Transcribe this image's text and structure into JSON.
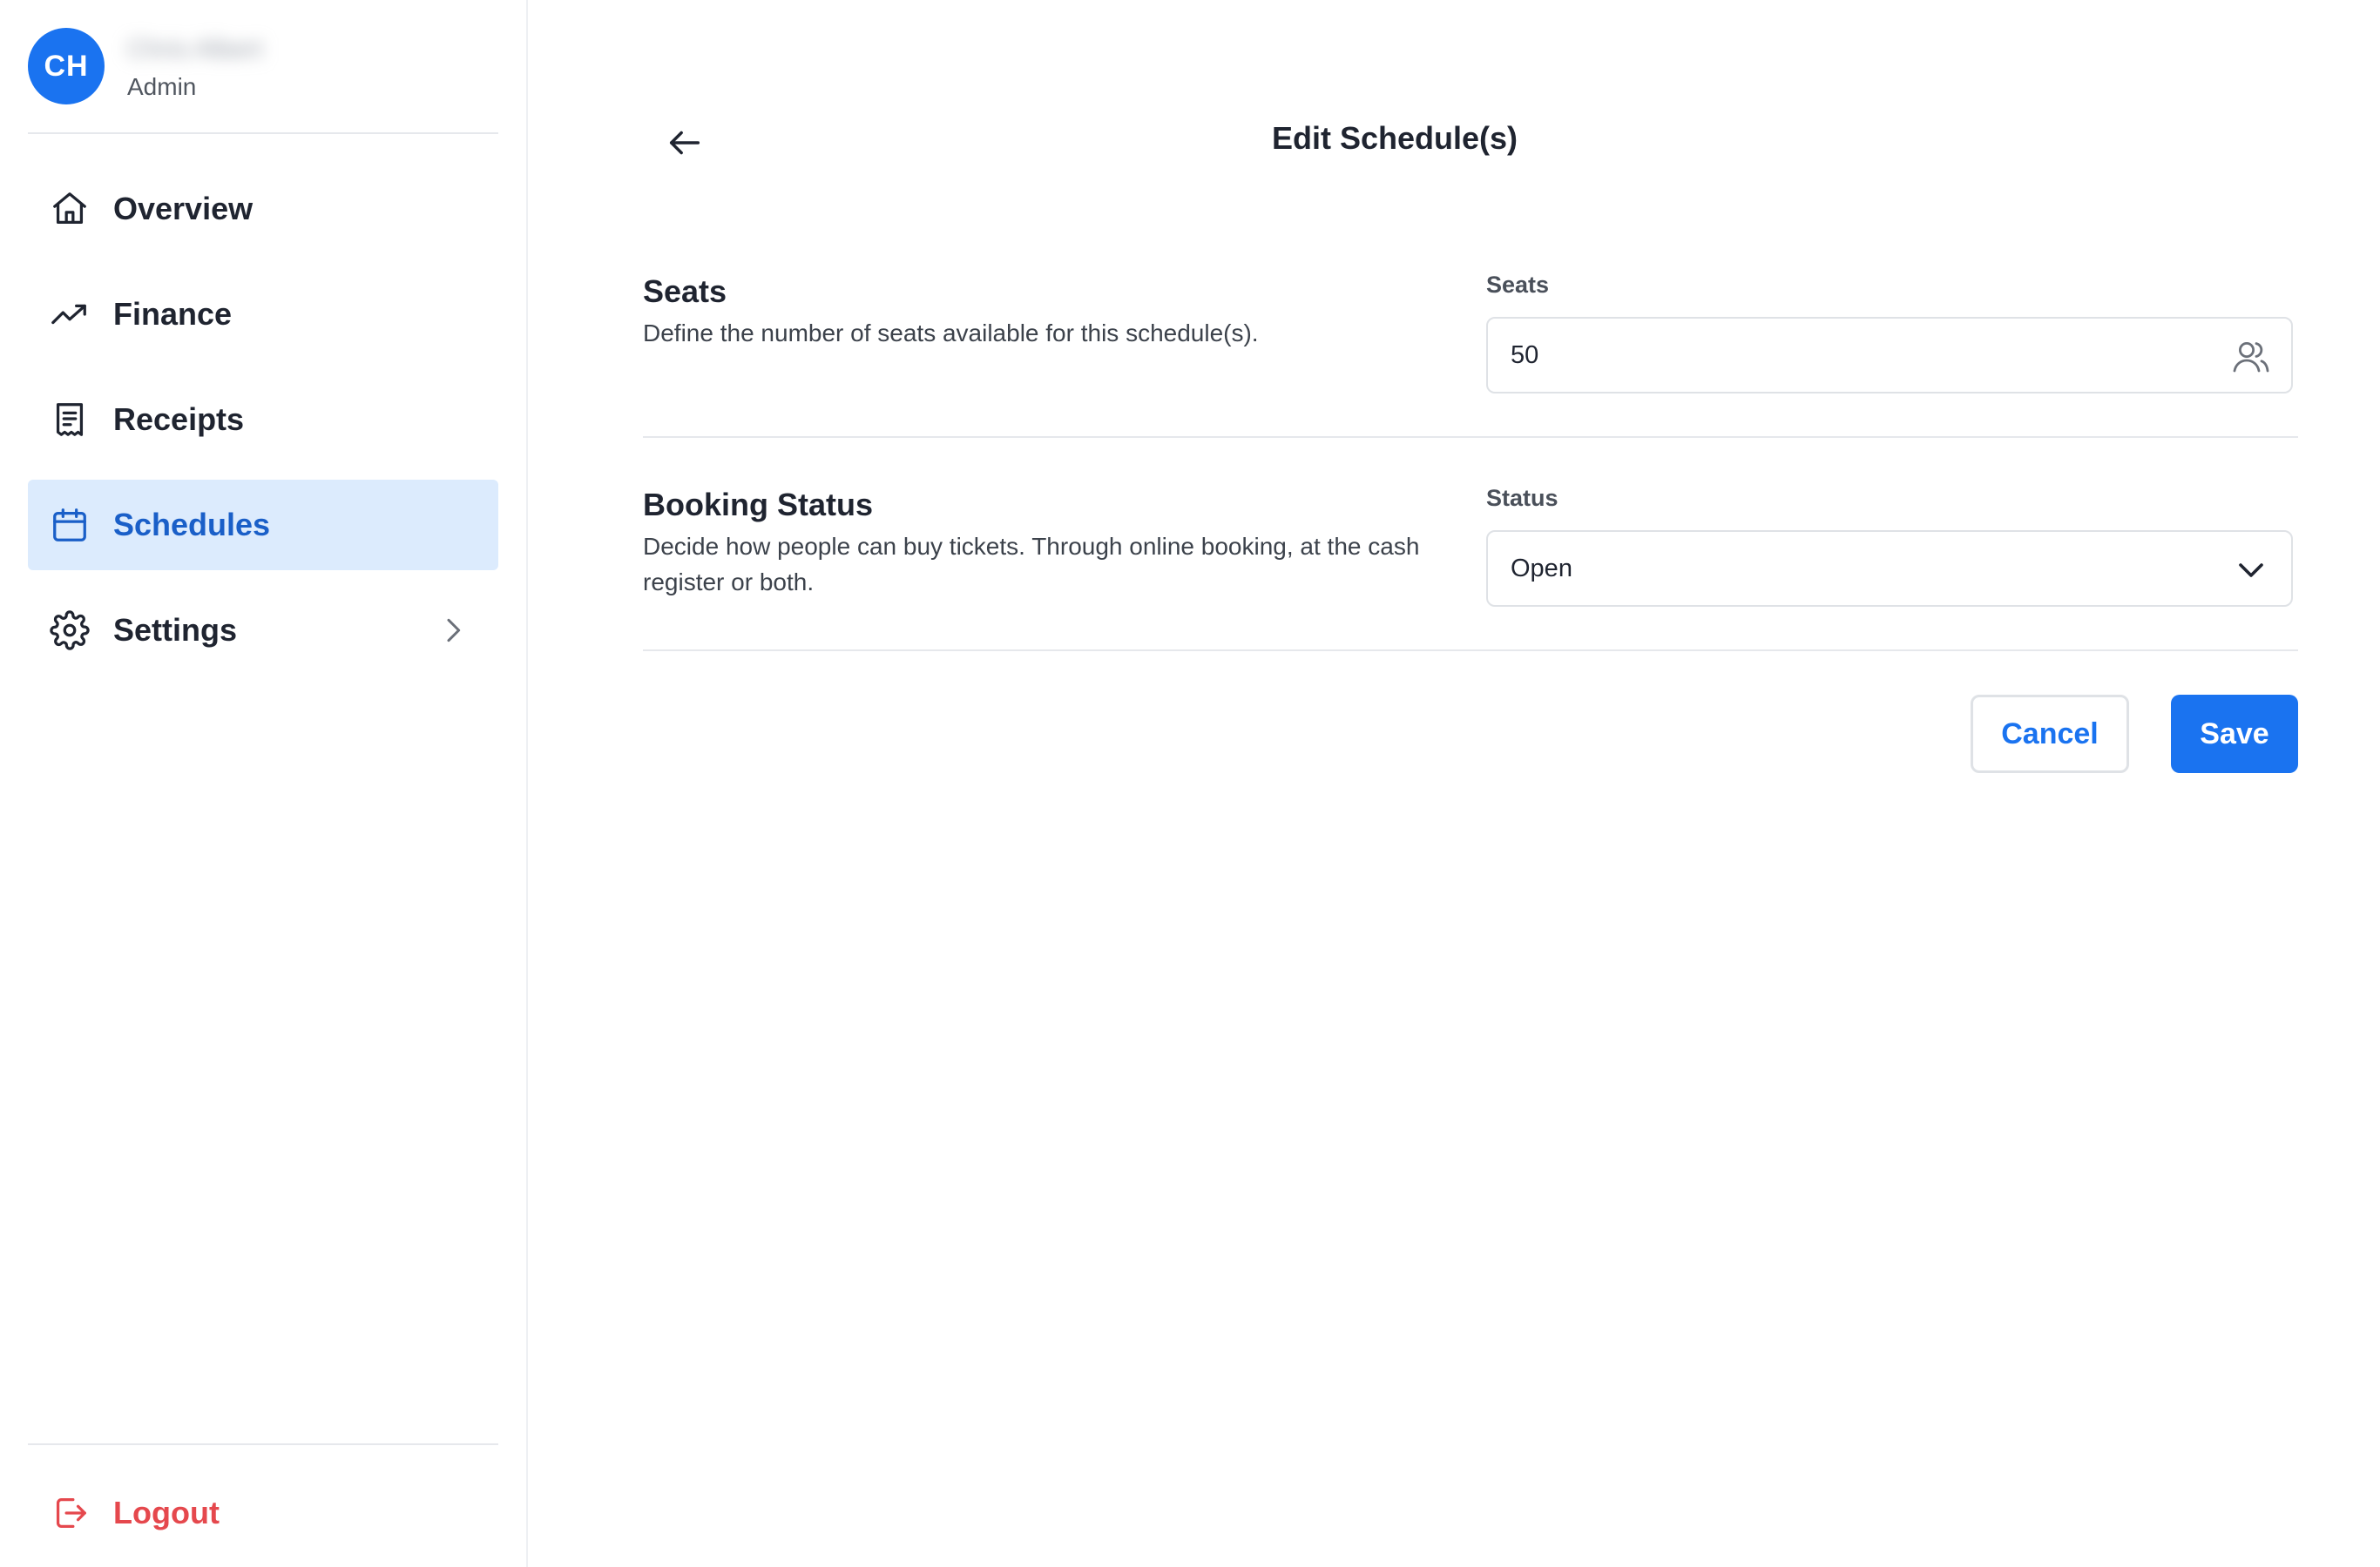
{
  "profile": {
    "initials": "CH",
    "name": "Chris Albert",
    "role": "Admin"
  },
  "nav": {
    "items": [
      {
        "label": "Overview",
        "icon": "home-icon"
      },
      {
        "label": "Finance",
        "icon": "trending-up-icon"
      },
      {
        "label": "Receipts",
        "icon": "receipt-icon"
      },
      {
        "label": "Schedules",
        "icon": "calendar-icon",
        "active": true
      },
      {
        "label": "Settings",
        "icon": "gear-icon",
        "has_submenu": true
      }
    ],
    "logout_label": "Logout"
  },
  "page": {
    "title": "Edit Schedule(s)"
  },
  "seats": {
    "heading": "Seats",
    "description": "Define the number of seats available for this schedule(s).",
    "field_label": "Seats",
    "value": "50",
    "icon": "users-icon"
  },
  "booking": {
    "heading": "Booking Status",
    "description": "Decide how people can buy tickets. Through online booking, at the cash register or both.",
    "field_label": "Status",
    "selected": "Open",
    "icon": "chevron-down-icon"
  },
  "actions": {
    "cancel_label": "Cancel",
    "save_label": "Save"
  },
  "colors": {
    "primary": "#1a73f0",
    "active_bg": "#dcebfd",
    "active_text": "#1a5fc8",
    "danger": "#e5484d"
  }
}
